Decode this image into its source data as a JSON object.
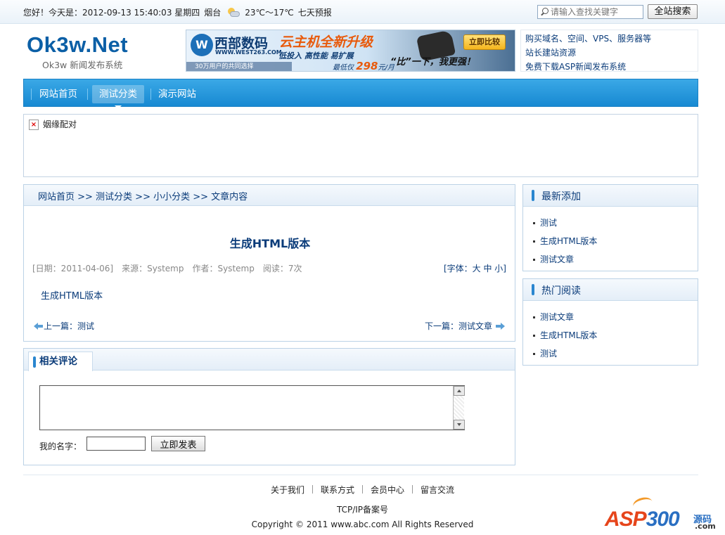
{
  "topbar": {
    "greeting": "您好！今天是：2012-09-13 15:40:03 星期四",
    "city": "烟台",
    "weather_icon": "partly-cloudy-icon",
    "temperature": "23℃～17℃",
    "forecast_link": "七天预报",
    "search_placeholder": "请输入查找关键字",
    "search_button": "全站搜索"
  },
  "header": {
    "logo": "Ok3w.Net",
    "logo_sub": "Ok3w 新闻发布系统",
    "banner": {
      "brand": "西部数码",
      "url": "WWW.WEST263.COM",
      "headline": "云主机全新升级",
      "features": "低投入 高性能 易扩展",
      "price_prefix": "最低仅",
      "price": "298",
      "price_suffix": "元/月",
      "users": "30万用户的共同选择",
      "cta": "立即比较",
      "slogan": "“比”一下，我更强！"
    },
    "links": [
      "购买域名、空间、VPS、服务器等",
      "站长建站资源",
      "免费下载ASP新闻发布系统"
    ]
  },
  "nav": {
    "items": [
      {
        "label": "网站首页"
      },
      {
        "label": "测试分类"
      },
      {
        "label": "演示网站"
      }
    ],
    "active_index": 1
  },
  "ad_panel": {
    "broken_image_alt": "姻缘配对"
  },
  "article": {
    "breadcrumb": "网站首页 >> 测试分类 >> 小小分类 >> 文章内容",
    "title": "生成HTML版本",
    "meta": "[日期：2011-04-06]　来源：Systemp　作者：Systemp　阅读：7次",
    "font_size": "[字体：大 中 小]",
    "body": "生成HTML版本",
    "prev": "上一篇：测试",
    "next": "下一篇：测试文章"
  },
  "comments": {
    "tab": "相关评论",
    "name_label": "我的名字：",
    "submit": "立即发表"
  },
  "sidebar": {
    "latest": {
      "title": "最新添加",
      "items": [
        "测试",
        "生成HTML版本",
        "测试文章"
      ]
    },
    "popular": {
      "title": "热门阅读",
      "items": [
        "测试文章",
        "生成HTML版本",
        "测试"
      ]
    }
  },
  "footer": {
    "links": [
      "关于我们",
      "联系方式",
      "会员中心",
      "留言交流"
    ],
    "icp": "TCP/IP备案号",
    "copyright": "Copyright © 2011 www.abc.com All Rights Reserved"
  },
  "watermark": {
    "text_a": "ASP",
    "text_b": "300",
    "tag": "源码",
    "domain": ".com"
  },
  "colors": {
    "nav_blue": "#1789d2",
    "link_blue": "#0b3c7a",
    "logo_blue": "#0b5fa6"
  }
}
